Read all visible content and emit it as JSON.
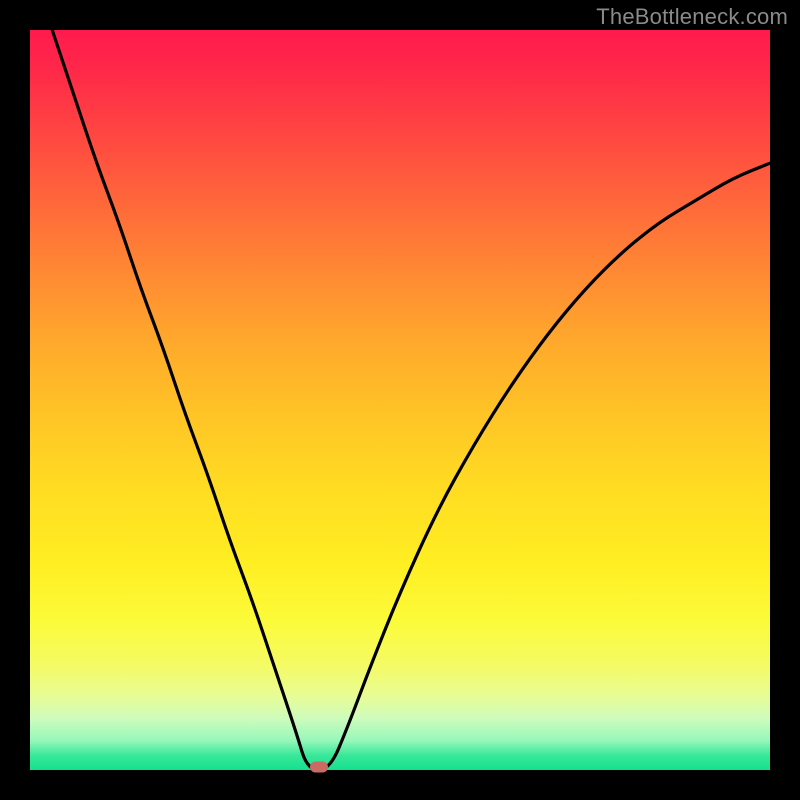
{
  "watermark": "TheBottleneck.com",
  "colors": {
    "background": "#000000",
    "curve_stroke": "#000000",
    "marker_fill": "#c96a63",
    "gradient": [
      "#ff1a4d",
      "#ffee22",
      "#13e18e"
    ]
  },
  "chart_data": {
    "type": "line",
    "title": "",
    "xlabel": "",
    "ylabel": "",
    "xlim": [
      0,
      100
    ],
    "ylim": [
      0,
      100
    ],
    "curve_comment": "V-shaped bottleneck curve; y is relative height 0-100 where 0 is bottom (green) and 100 is top (red). Minimum (optimal / no bottleneck) at x≈38.5.",
    "x": [
      3,
      6,
      9,
      12,
      15,
      18,
      21,
      24,
      27,
      30,
      33,
      36,
      37.5,
      40.5,
      43,
      46,
      50,
      55,
      60,
      65,
      70,
      75,
      80,
      85,
      90,
      95,
      100
    ],
    "y": [
      100,
      91,
      82,
      74,
      65,
      57,
      48,
      40,
      31,
      23,
      14,
      5,
      0,
      0,
      6,
      14,
      24,
      35,
      44,
      52,
      59,
      65,
      70,
      74,
      77,
      80,
      82
    ],
    "minimum_marker": {
      "x": 39,
      "y": 0
    },
    "flat_bottom_range": [
      37.5,
      40.5
    ]
  }
}
